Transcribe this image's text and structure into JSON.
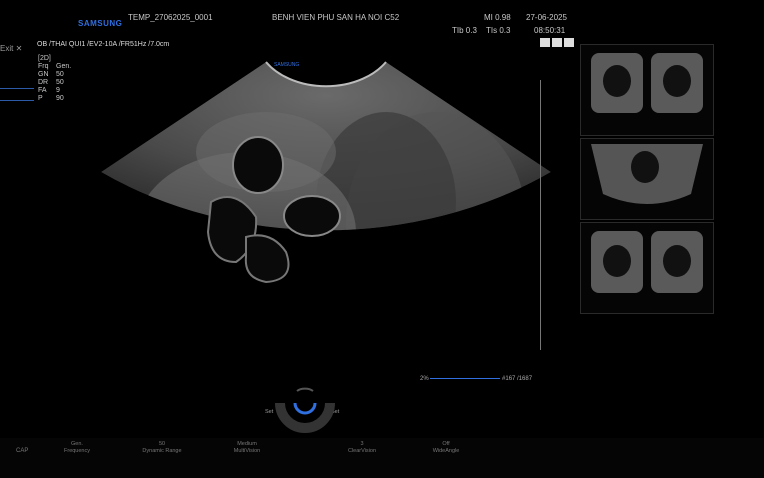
{
  "header": {
    "brand": "SAMSUNG",
    "patient_id": "TEMP_27062025_0001",
    "hospital": "BENH VIEN PHU SAN HA NOI C52",
    "mi": "MI 0.98",
    "tib": "TIb 0.3",
    "tis": "TIs 0.3",
    "date": "27-06-2025",
    "time": "08:50:31"
  },
  "exit_label": "Exit",
  "preset_line": "OB /THAI QUI1 /EV2-10A /FR51Hz /7.0cm",
  "mode": "[2D]",
  "params": [
    {
      "name": "Frq",
      "value": "Gen."
    },
    {
      "name": "GN",
      "value": "50"
    },
    {
      "name": "DR",
      "value": "50"
    },
    {
      "name": "FA",
      "value": "9"
    },
    {
      "name": "P",
      "value": "90"
    }
  ],
  "probe_brand": "SAMSUNG",
  "tgc": {
    "left": "2%",
    "right": "#167 /1687"
  },
  "set_left": "Set",
  "set_right": "Set",
  "cap_label": "CAP",
  "bottom_controls": [
    {
      "top": "Gen.",
      "bottom": "Frequency"
    },
    {
      "top": "50",
      "bottom": "Dynamic Range"
    },
    {
      "top": "Medium",
      "bottom": "MultiVision"
    },
    {
      "top": "3",
      "bottom": "ClearVision"
    },
    {
      "top": "Off",
      "bottom": "WideAngle"
    }
  ],
  "colors": {
    "accent": "#2f6fe0",
    "background": "#000000"
  }
}
